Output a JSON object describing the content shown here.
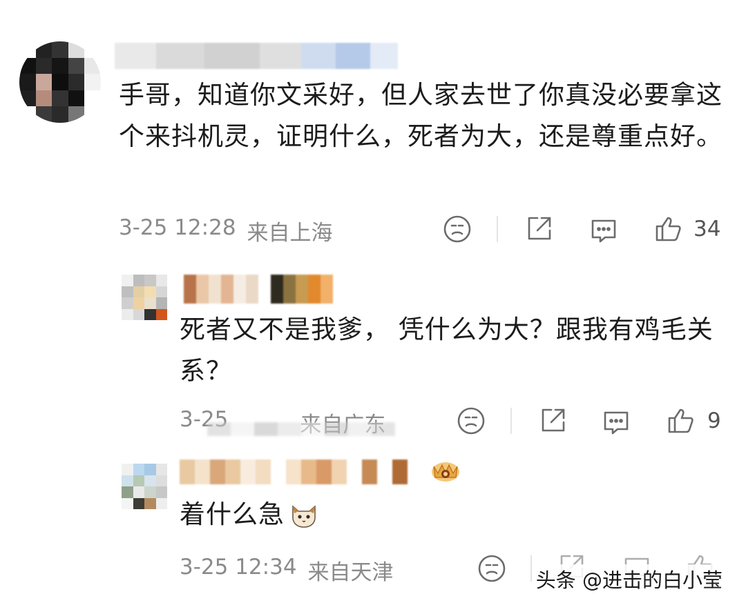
{
  "comments": [
    {
      "text": "手哥，知道你文采好，但人家去世了你真没必要拿这个来抖机灵，证明什么，死者为大，还是尊重点好。",
      "date": "3-25 12:28",
      "location": "来自上海",
      "likes": "34"
    },
    {
      "text": "死者又不是我爹， 凭什么为大？跟我有鸡毛关系？",
      "date": "3-25",
      "location": "来自广东",
      "likes": "9"
    },
    {
      "text": "着什么急",
      "date": "3-25 12:34",
      "location": "来自天津",
      "likes": ""
    }
  ],
  "icons": {
    "face": "sad-face-icon",
    "share": "share-icon",
    "reply": "comment-icon",
    "like": "thumbs-up-icon",
    "emoji": "cat-emoji-icon",
    "badge": "crown-badge-icon"
  },
  "colors": {
    "meta_text": "#8a8a8a",
    "icon_stroke": "#6b6b6b",
    "body_text": "#1c1c1c"
  },
  "watermark": "头条 @进击的白小莹"
}
